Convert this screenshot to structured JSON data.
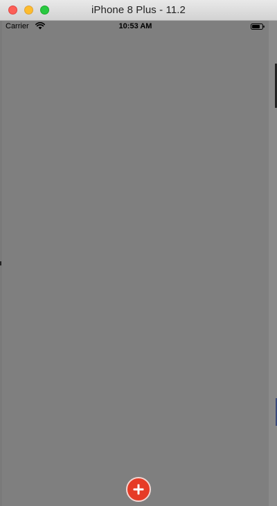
{
  "window": {
    "title": "iPhone 8 Plus - 11.2"
  },
  "status_bar": {
    "carrier": "Carrier",
    "time": "10:53 AM",
    "wifi_icon": "wifi-icon",
    "battery_icon": "battery-icon"
  },
  "add_button": {
    "icon": "plus-icon",
    "color": "#e63b26"
  },
  "colors": {
    "screen_background": "#7f7f7f",
    "close": "#fc5f57",
    "minimize": "#fdbc2e",
    "zoom": "#28c840"
  }
}
